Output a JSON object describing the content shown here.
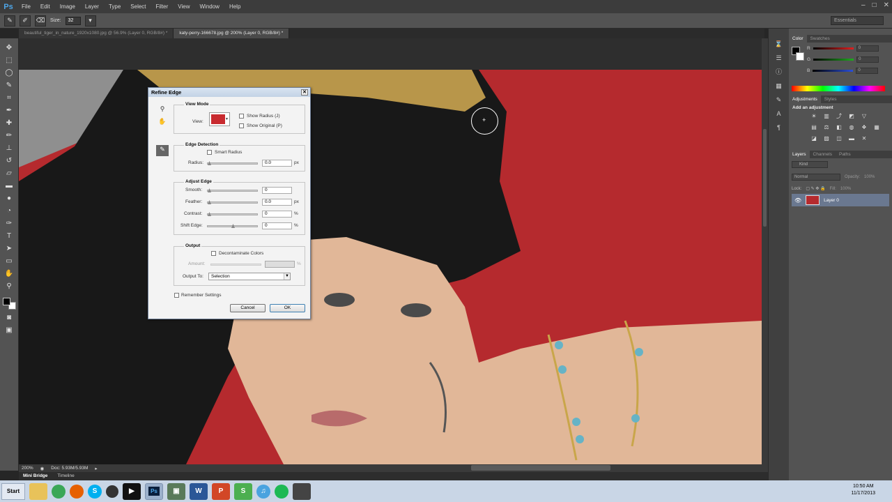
{
  "app": {
    "logo": "Ps",
    "window_controls": [
      "–",
      "□",
      "✕"
    ]
  },
  "menu": [
    "File",
    "Edit",
    "Image",
    "Layer",
    "Type",
    "Select",
    "Filter",
    "View",
    "Window",
    "Help"
  ],
  "options_bar": {
    "size_label": "Size:",
    "size_value": "32",
    "workspace": "Essentials"
  },
  "tabs": [
    {
      "label": "beautiful_tiger_in_nature_1920x1080.jpg @ 56.9% (Layer 0, RGB/8#) *",
      "active": false
    },
    {
      "label": "katy-perry-166678.jpg @ 200% (Layer 0, RGB/8#) *",
      "active": true
    }
  ],
  "status": {
    "zoom": "200%",
    "doc": "Doc: 5.93M/5.93M"
  },
  "mini_bridge": {
    "tab1": "Mini Bridge",
    "tab2": "Timeline"
  },
  "panels": {
    "color_tabs": [
      "Color",
      "Swatches"
    ],
    "color_channels": [
      {
        "label": "R",
        "value": "0"
      },
      {
        "label": "G",
        "value": "0"
      },
      {
        "label": "B",
        "value": "0"
      }
    ],
    "adjust_tabs": [
      "Adjustments",
      "Styles"
    ],
    "adjust_heading": "Add an adjustment",
    "layers_tabs": [
      "Layers",
      "Channels",
      "Paths"
    ],
    "kind_label": "Kind",
    "blend_mode": "Normal",
    "opacity_label": "Opacity:",
    "opacity_value": "100%",
    "lock_label": "Lock:",
    "fill_label": "Fill:",
    "fill_value": "100%",
    "layer_name": "Layer 0",
    "colors": {
      "red": "#e02020",
      "green": "#1faa1f",
      "blue": "#2b4fd8"
    }
  },
  "dialog": {
    "title": "Refine Edge",
    "view_mode": {
      "heading": "View Mode",
      "view_label": "View:",
      "show_radius": "Show Radius (J)",
      "show_original": "Show Original (P)"
    },
    "edge_detection": {
      "heading": "Edge Detection",
      "smart_radius": "Smart Radius",
      "radius_label": "Radius:",
      "radius_value": "0.0",
      "radius_unit": "px"
    },
    "adjust_edge": {
      "heading": "Adjust Edge",
      "smooth_label": "Smooth:",
      "smooth_value": "0",
      "feather_label": "Feather:",
      "feather_value": "0.0",
      "feather_unit": "px",
      "contrast_label": "Contrast:",
      "contrast_value": "0",
      "contrast_unit": "%",
      "shift_label": "Shift Edge:",
      "shift_value": "0",
      "shift_unit": "%"
    },
    "output": {
      "heading": "Output",
      "decontaminate": "Decontaminate Colors",
      "amount_label": "Amount:",
      "amount_unit": "%",
      "output_to_label": "Output To:",
      "output_to_value": "Selection"
    },
    "remember": "Remember Settings",
    "cancel": "Cancel",
    "ok": "OK"
  },
  "taskbar": {
    "start": "Start",
    "time": "10:50 AM",
    "date": "11/17/2013"
  }
}
